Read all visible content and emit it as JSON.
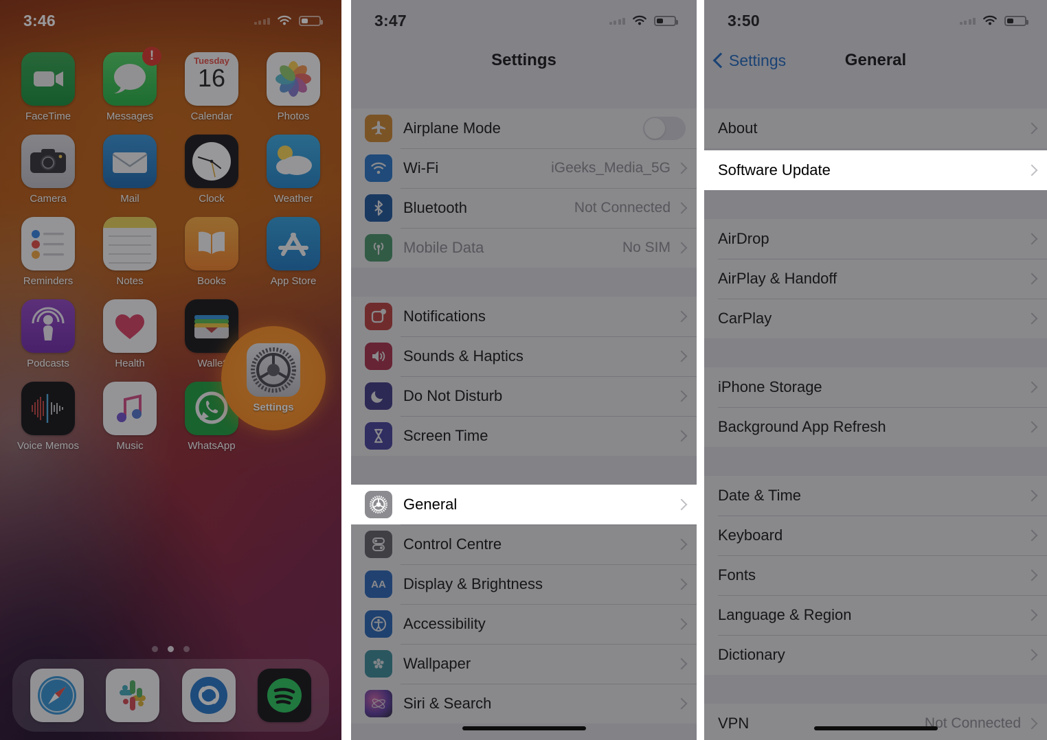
{
  "panel_home": {
    "status": {
      "time": "3:46",
      "wifi_icon": "wifi-icon",
      "battery_icon": "battery-low-icon",
      "signal_icon": "signal-dots-icon"
    },
    "rows": [
      [
        {
          "label": "FaceTime",
          "icon": "facetime-icon",
          "badge": ""
        },
        {
          "label": "Messages",
          "icon": "messages-icon",
          "badge": "!"
        },
        {
          "label": "Calendar",
          "icon": "calendar-icon",
          "badge": "",
          "cal_weekday": "Tuesday",
          "cal_day": "16"
        },
        {
          "label": "Photos",
          "icon": "photos-icon",
          "badge": ""
        }
      ],
      [
        {
          "label": "Camera",
          "icon": "camera-icon",
          "badge": ""
        },
        {
          "label": "Mail",
          "icon": "mail-icon",
          "badge": ""
        },
        {
          "label": "Clock",
          "icon": "clock-icon",
          "badge": ""
        },
        {
          "label": "Weather",
          "icon": "weather-icon",
          "badge": ""
        }
      ],
      [
        {
          "label": "Reminders",
          "icon": "reminders-icon",
          "badge": ""
        },
        {
          "label": "Notes",
          "icon": "notes-icon",
          "badge": ""
        },
        {
          "label": "Books",
          "icon": "books-icon",
          "badge": ""
        },
        {
          "label": "App Store",
          "icon": "appstore-icon",
          "badge": ""
        }
      ],
      [
        {
          "label": "Podcasts",
          "icon": "podcasts-icon",
          "badge": ""
        },
        {
          "label": "Health",
          "icon": "health-icon",
          "badge": ""
        },
        {
          "label": "Wallet",
          "icon": "wallet-icon",
          "badge": ""
        },
        {
          "label": "Settings",
          "icon": "settings-gear-icon",
          "badge": ""
        }
      ],
      [
        {
          "label": "Voice Memos",
          "icon": "voicememos-icon",
          "badge": ""
        },
        {
          "label": "Music",
          "icon": "music-icon",
          "badge": ""
        },
        {
          "label": "WhatsApp",
          "icon": "whatsapp-icon",
          "badge": ""
        }
      ]
    ],
    "highlight": {
      "label": "Settings",
      "icon": "settings-gear-icon",
      "ring_color": "#f9870f"
    },
    "page_dots": {
      "count": 3,
      "active_index": 1
    },
    "dock": [
      {
        "label": "Safari",
        "icon": "safari-icon"
      },
      {
        "label": "Slack",
        "icon": "slack-icon"
      },
      {
        "label": "Shazam",
        "icon": "shazam-icon"
      },
      {
        "label": "Spotify",
        "icon": "spotify-icon"
      }
    ]
  },
  "panel_settings": {
    "status": {
      "time": "3:47"
    },
    "title": "Settings",
    "groups": [
      {
        "rows": [
          {
            "label": "Airplane Mode",
            "icon": "airplane-icon",
            "icon_color": "#e08a1e",
            "control": "toggle",
            "value": "",
            "disabled": false
          },
          {
            "label": "Wi-Fi",
            "icon": "wifi-icon",
            "icon_color": "#1573d6",
            "control": "chevron",
            "value": "iGeeks_Media_5G",
            "disabled": false
          },
          {
            "label": "Bluetooth",
            "icon": "bluetooth-icon",
            "icon_color": "#0a4fa0",
            "control": "chevron",
            "value": "Not Connected",
            "disabled": false
          },
          {
            "label": "Mobile Data",
            "icon": "cellular-icon",
            "icon_color": "#3f9a63",
            "control": "chevron",
            "value": "No SIM",
            "disabled": true
          }
        ]
      },
      {
        "rows": [
          {
            "label": "Notifications",
            "icon": "notifications-icon",
            "icon_color": "#c8322b",
            "control": "chevron",
            "value": "",
            "disabled": false
          },
          {
            "label": "Sounds & Haptics",
            "icon": "sounds-icon",
            "icon_color": "#b31f3c",
            "control": "chevron",
            "value": "",
            "disabled": false
          },
          {
            "label": "Do Not Disturb",
            "icon": "moon-icon",
            "icon_color": "#342a86",
            "control": "chevron",
            "value": "",
            "disabled": false
          },
          {
            "label": "Screen Time",
            "icon": "hourglass-icon",
            "icon_color": "#3a33a0",
            "control": "chevron",
            "value": "",
            "disabled": false
          }
        ]
      },
      {
        "highlight_index": 0,
        "rows": [
          {
            "label": "General",
            "icon": "settings-gear-icon",
            "icon_color": "#8b8b90",
            "control": "chevron",
            "value": "",
            "disabled": false
          },
          {
            "label": "Control Centre",
            "icon": "control-centre-icon",
            "icon_color": "#5b5b60",
            "control": "chevron",
            "value": "",
            "disabled": false
          },
          {
            "label": "Display & Brightness",
            "icon": "display-brightness-icon",
            "icon_color": "#1a62c4",
            "control": "chevron",
            "value": "",
            "disabled": false
          },
          {
            "label": "Accessibility",
            "icon": "accessibility-icon",
            "icon_color": "#1560bf",
            "control": "chevron",
            "value": "",
            "disabled": false
          },
          {
            "label": "Wallpaper",
            "icon": "wallpaper-icon",
            "icon_color": "#2d8f9c",
            "control": "chevron",
            "value": "",
            "disabled": false
          },
          {
            "label": "Siri & Search",
            "icon": "siri-icon",
            "icon_color": "#1d1d28",
            "control": "chevron",
            "value": "",
            "disabled": false
          }
        ]
      }
    ]
  },
  "panel_general": {
    "status": {
      "time": "3:50"
    },
    "back_label": "Settings",
    "title": "General",
    "groups": [
      {
        "rows": [
          {
            "label": "About",
            "value": ""
          }
        ]
      },
      {
        "highlight_index": 0,
        "rows": [
          {
            "label": "Software Update",
            "value": ""
          }
        ]
      },
      {
        "rows": [
          {
            "label": "AirDrop",
            "value": ""
          },
          {
            "label": "AirPlay & Handoff",
            "value": ""
          },
          {
            "label": "CarPlay",
            "value": ""
          }
        ]
      },
      {
        "rows": [
          {
            "label": "iPhone Storage",
            "value": ""
          },
          {
            "label": "Background App Refresh",
            "value": ""
          }
        ]
      },
      {
        "rows": [
          {
            "label": "Date & Time",
            "value": ""
          },
          {
            "label": "Keyboard",
            "value": ""
          },
          {
            "label": "Fonts",
            "value": ""
          },
          {
            "label": "Language & Region",
            "value": ""
          },
          {
            "label": "Dictionary",
            "value": ""
          }
        ]
      },
      {
        "rows": [
          {
            "label": "VPN",
            "value": "Not Connected"
          }
        ]
      }
    ]
  }
}
